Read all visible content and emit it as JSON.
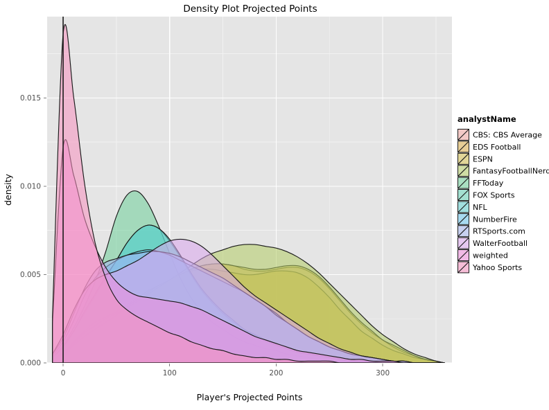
{
  "title": "Density Plot Projected Points",
  "axes": {
    "xlabel": "Player's Projected Points",
    "ylabel": "density",
    "x_ticks": [
      "0",
      "100",
      "200",
      "300"
    ],
    "x_tick_values": [
      0,
      100,
      200,
      300
    ],
    "x_minor_values": [
      50,
      150,
      250,
      350
    ],
    "y_ticks": [
      "0.000",
      "0.005",
      "0.010",
      "0.015"
    ],
    "y_tick_values": [
      0.0,
      0.005,
      0.01,
      0.015
    ],
    "y_minor_values": [
      0.0025,
      0.0075,
      0.0125,
      0.0175
    ],
    "xlim": [
      -15,
      365
    ],
    "ylim": [
      0,
      0.0196
    ]
  },
  "legend": {
    "title": "analystName",
    "items": [
      {
        "label": "CBS: CBS Average",
        "color": "#f2a8a2"
      },
      {
        "label": "EDS Football",
        "color": "#deb14a"
      },
      {
        "label": "ESPN",
        "color": "#d4c04f"
      },
      {
        "label": "FantasyFootballNerd",
        "color": "#b3cc65"
      },
      {
        "label": "FFToday",
        "color": "#6ecf99"
      },
      {
        "label": "FOX Sports",
        "color": "#63d3b6"
      },
      {
        "label": "NFL",
        "color": "#5ecfcf"
      },
      {
        "label": "NumberFire",
        "color": "#69c7ef"
      },
      {
        "label": "RTSports.com",
        "color": "#a4b5ee"
      },
      {
        "label": "WalterFootball",
        "color": "#dba5ef"
      },
      {
        "label": "weighted",
        "color": "#f08ddd"
      },
      {
        "label": "Yahoo Sports",
        "color": "#f792bf"
      }
    ]
  },
  "chart_data": {
    "type": "area",
    "title": "Density Plot Projected Points",
    "xlabel": "Player's Projected Points",
    "ylabel": "density",
    "xlim": [
      -15,
      365
    ],
    "ylim": [
      0,
      0.0196
    ],
    "grid": true,
    "legend_position": "right",
    "legend_title": "analystName",
    "fill_alpha": 0.55,
    "x": [
      -10,
      0,
      10,
      20,
      30,
      40,
      50,
      60,
      70,
      80,
      90,
      100,
      110,
      120,
      130,
      140,
      150,
      160,
      170,
      180,
      190,
      200,
      210,
      220,
      230,
      240,
      250,
      260,
      270,
      280,
      290,
      300,
      310,
      320,
      330,
      340,
      350,
      358
    ],
    "series": [
      {
        "name": "CBS: CBS Average",
        "color": "#f2a8a2",
        "values": [
          0.0001,
          0.0004,
          0.0009,
          0.0015,
          0.0019,
          0.0022,
          0.0025,
          0.0029,
          0.0033,
          0.0038,
          0.0042,
          0.0046,
          0.005,
          0.0053,
          0.0055,
          0.0056,
          0.0056,
          0.0055,
          0.0053,
          0.0052,
          0.0052,
          0.0053,
          0.0054,
          0.0054,
          0.0052,
          0.0048,
          0.0042,
          0.0035,
          0.0028,
          0.0022,
          0.0017,
          0.0013,
          0.0009,
          0.0006,
          0.0004,
          0.0002,
          0.0001,
          0.0
        ]
      },
      {
        "name": "EDS Football",
        "color": "#deb14a",
        "values": [
          0.0002,
          0.0006,
          0.0012,
          0.0018,
          0.0023,
          0.0026,
          0.0029,
          0.0033,
          0.0037,
          0.0041,
          0.0044,
          0.0047,
          0.005,
          0.0052,
          0.0053,
          0.0053,
          0.0052,
          0.0051,
          0.005,
          0.005,
          0.0051,
          0.0052,
          0.0052,
          0.0051,
          0.0048,
          0.0043,
          0.0037,
          0.003,
          0.0024,
          0.0018,
          0.0014,
          0.001,
          0.0007,
          0.0005,
          0.0003,
          0.0002,
          0.0001,
          0.0
        ]
      },
      {
        "name": "ESPN",
        "color": "#d4c04f",
        "values": [
          0.0002,
          0.0006,
          0.0011,
          0.0017,
          0.0021,
          0.0025,
          0.0028,
          0.0032,
          0.0036,
          0.004,
          0.0044,
          0.0047,
          0.005,
          0.0053,
          0.0055,
          0.0056,
          0.0056,
          0.0055,
          0.0054,
          0.0053,
          0.0053,
          0.0054,
          0.0055,
          0.0055,
          0.0053,
          0.0049,
          0.0043,
          0.0036,
          0.0029,
          0.0023,
          0.0018,
          0.0013,
          0.001,
          0.0007,
          0.0004,
          0.0002,
          0.0001,
          0.0
        ]
      },
      {
        "name": "FantasyFootballNerd",
        "color": "#b3cc65",
        "values": [
          0.0002,
          0.0005,
          0.001,
          0.0015,
          0.0019,
          0.0023,
          0.0027,
          0.0031,
          0.0035,
          0.0039,
          0.0043,
          0.0047,
          0.0051,
          0.0055,
          0.0059,
          0.0062,
          0.0064,
          0.0066,
          0.0067,
          0.0067,
          0.0066,
          0.0065,
          0.0063,
          0.006,
          0.0056,
          0.0051,
          0.0045,
          0.0039,
          0.0033,
          0.0027,
          0.0021,
          0.0016,
          0.0012,
          0.0008,
          0.0005,
          0.0003,
          0.0001,
          0.0
        ]
      },
      {
        "name": "FFToday",
        "color": "#6ecf99",
        "values": [
          0.0003,
          0.001,
          0.002,
          0.0032,
          0.0046,
          0.0063,
          0.0083,
          0.0095,
          0.0097,
          0.009,
          0.0077,
          0.0062,
          0.0048,
          0.0037,
          0.0029,
          0.0023,
          0.0019,
          0.0015,
          0.0012,
          0.001,
          0.0008,
          0.0007,
          0.0005,
          0.0004,
          0.0003,
          0.0002,
          0.0002,
          0.0001,
          0.0001,
          0.0001,
          0.0,
          0.0,
          0.0,
          0.0,
          0.0,
          0.0,
          0.0,
          0.0
        ]
      },
      {
        "name": "FOX Sports",
        "color": "#63d3b6",
        "values": [
          0.0003,
          0.0009,
          0.0018,
          0.0028,
          0.0038,
          0.0048,
          0.0058,
          0.0068,
          0.0075,
          0.0078,
          0.0076,
          0.0069,
          0.006,
          0.005,
          0.0041,
          0.0034,
          0.0028,
          0.0023,
          0.0019,
          0.0015,
          0.0012,
          0.001,
          0.0008,
          0.0006,
          0.0005,
          0.0004,
          0.0003,
          0.0002,
          0.0001,
          0.0001,
          0.0001,
          0.0,
          0.0,
          0.0,
          0.0,
          0.0,
          0.0,
          0.0
        ]
      },
      {
        "name": "NFL",
        "color": "#5ecfcf",
        "values": [
          0.0003,
          0.0009,
          0.0018,
          0.0029,
          0.0039,
          0.0049,
          0.0058,
          0.0068,
          0.0075,
          0.0078,
          0.0076,
          0.007,
          0.0061,
          0.0051,
          0.0042,
          0.0035,
          0.0029,
          0.0024,
          0.0019,
          0.0016,
          0.0013,
          0.001,
          0.0008,
          0.0006,
          0.0005,
          0.0004,
          0.0003,
          0.0002,
          0.0001,
          0.0001,
          0.0001,
          0.0,
          0.0,
          0.0,
          0.0,
          0.0,
          0.0,
          0.0
        ]
      },
      {
        "name": "NumberFire",
        "color": "#69c7ef",
        "values": [
          0.0004,
          0.0012,
          0.0024,
          0.0038,
          0.0048,
          0.0054,
          0.0058,
          0.0061,
          0.0063,
          0.0064,
          0.0063,
          0.0061,
          0.0058,
          0.0055,
          0.0052,
          0.0049,
          0.0046,
          0.0043,
          0.004,
          0.0036,
          0.0032,
          0.0028,
          0.0023,
          0.0019,
          0.0015,
          0.0012,
          0.0009,
          0.0007,
          0.0005,
          0.0004,
          0.0003,
          0.0002,
          0.0001,
          0.0001,
          0.0,
          0.0,
          0.0,
          0.0
        ]
      },
      {
        "name": "RTSports.com",
        "color": "#a4b5ee",
        "values": [
          0.0005,
          0.0014,
          0.0028,
          0.0042,
          0.0052,
          0.0057,
          0.0059,
          0.0061,
          0.0062,
          0.0063,
          0.0063,
          0.0062,
          0.006,
          0.0057,
          0.0054,
          0.0051,
          0.0048,
          0.0044,
          0.004,
          0.0036,
          0.0032,
          0.0027,
          0.0023,
          0.0019,
          0.0015,
          0.0012,
          0.0009,
          0.0007,
          0.0005,
          0.0004,
          0.0003,
          0.0002,
          0.0001,
          0.0001,
          0.0,
          0.0,
          0.0,
          0.0
        ]
      },
      {
        "name": "WalterFootball",
        "color": "#dba5ef",
        "values": [
          0.0005,
          0.0016,
          0.003,
          0.0041,
          0.0047,
          0.005,
          0.0052,
          0.0055,
          0.0058,
          0.0062,
          0.0066,
          0.0069,
          0.007,
          0.0069,
          0.0066,
          0.0061,
          0.0055,
          0.0049,
          0.0043,
          0.0038,
          0.0034,
          0.003,
          0.0026,
          0.0022,
          0.0018,
          0.0014,
          0.0011,
          0.0008,
          0.0006,
          0.0004,
          0.0003,
          0.0002,
          0.0001,
          0.0001,
          0.0,
          0.0,
          0.0,
          0.0
        ]
      },
      {
        "name": "weighted",
        "color": "#f08ddd",
        "values": [
          0.0022,
          0.0122,
          0.0106,
          0.0082,
          0.0066,
          0.0054,
          0.0046,
          0.0041,
          0.0038,
          0.0037,
          0.0036,
          0.0035,
          0.0034,
          0.0032,
          0.003,
          0.0027,
          0.0024,
          0.0021,
          0.0018,
          0.0015,
          0.0013,
          0.0011,
          0.0009,
          0.0007,
          0.0006,
          0.0005,
          0.0004,
          0.0003,
          0.0002,
          0.0002,
          0.0001,
          0.0001,
          0.0001,
          0.0,
          0.0,
          0.0,
          0.0,
          0.0
        ]
      },
      {
        "name": "Yahoo Sports",
        "color": "#f792bf",
        "values": [
          0.0026,
          0.0186,
          0.015,
          0.0102,
          0.0068,
          0.0048,
          0.0036,
          0.003,
          0.0026,
          0.0023,
          0.002,
          0.0017,
          0.0015,
          0.0012,
          0.001,
          0.0008,
          0.0007,
          0.0005,
          0.0004,
          0.0003,
          0.0003,
          0.0002,
          0.0002,
          0.0001,
          0.0001,
          0.0001,
          0.0001,
          0.0,
          0.0,
          0.0,
          0.0,
          0.0,
          0.0,
          0.0,
          0.0,
          0.0,
          0.0,
          0.0
        ]
      }
    ]
  }
}
